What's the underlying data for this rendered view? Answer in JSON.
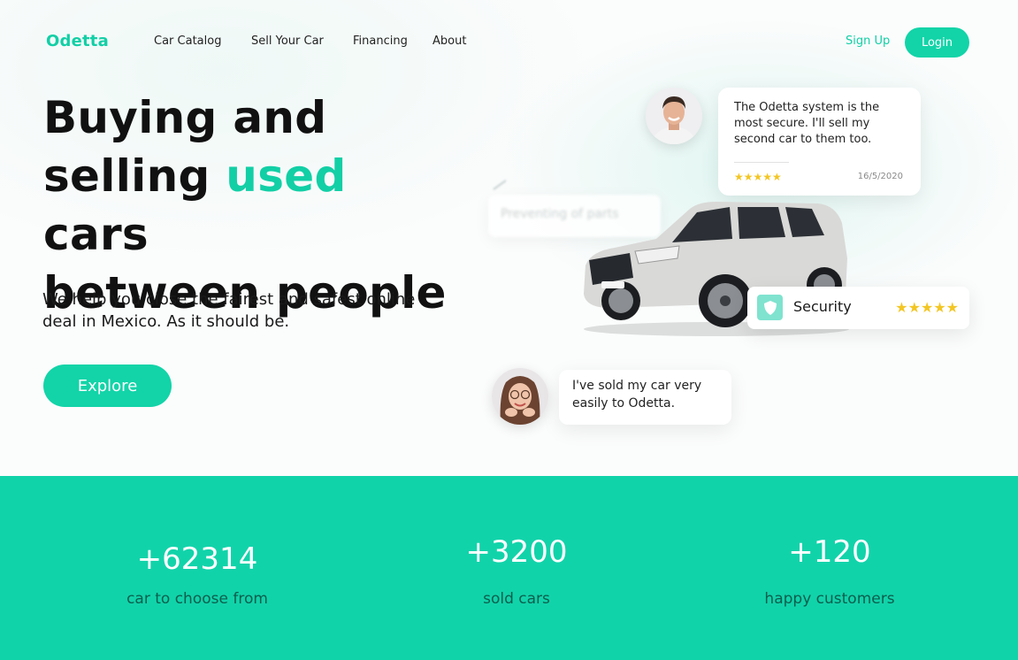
{
  "brand": {
    "name": "Odetta",
    "accent": "#12cfa6"
  },
  "nav": {
    "links": [
      "Car Catalog",
      "Sell Your Car",
      "Financing",
      "About"
    ],
    "signup": "Sign Up",
    "login": "Login"
  },
  "hero": {
    "headline_line1": "Buying and",
    "headline_line2_pre": "selling ",
    "headline_line2_accent": "used",
    "headline_line2_post": " cars",
    "headline_line3": "between people",
    "subtitle": "We help you close the fairest and safest online deal in Mexico. As it should be.",
    "explore": "Explore"
  },
  "review": {
    "text": "The Odetta system is the most secure. I'll sell my second car to them too.",
    "stars": "★★★★★",
    "date": "16/5/2020"
  },
  "ghost": {
    "text": "Preventing of parts"
  },
  "security": {
    "label": "Security",
    "stars": "★★★★★"
  },
  "quote": {
    "text": "I've sold my car very easily to Odetta."
  },
  "stats": [
    {
      "value": "+62314",
      "label": "car to choose from"
    },
    {
      "value": "+3200",
      "label": "sold cars"
    },
    {
      "value": "+120",
      "label": "happy customers"
    }
  ]
}
